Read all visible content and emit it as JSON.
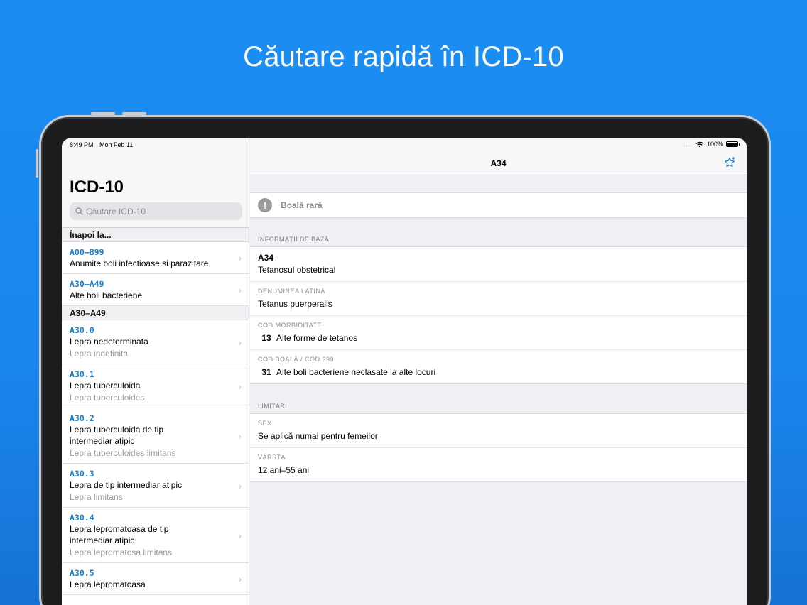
{
  "headline": "Căutare rapidă în ICD-10",
  "status_bar": {
    "time": "8:49 PM",
    "date": "Mon Feb 11",
    "battery": "100%",
    "dots": "...."
  },
  "master": {
    "title": "ICD-10",
    "search_placeholder": "Căutare ICD-10",
    "back_header": "Înapoi la...",
    "parents": [
      {
        "code": "A00–B99",
        "name": "Anumite boli infectioase si parazitare"
      },
      {
        "code": "A30–A49",
        "name": "Alte boli bacteriene"
      }
    ],
    "section_header": "A30–A49",
    "items": [
      {
        "code": "A30.0",
        "name": "Lepra nedeterminata",
        "latin": "Lepra indefinita"
      },
      {
        "code": "A30.1",
        "name": "Lepra tuberculoida",
        "latin": "Lepra tuberculoides"
      },
      {
        "code": "A30.2",
        "name": "Lepra tuberculoida de tip intermediar atipic",
        "latin": "Lepra tuberculoides limitans"
      },
      {
        "code": "A30.3",
        "name": "Lepra de tip intermediar atipic",
        "latin": "Lepra limitans"
      },
      {
        "code": "A30.4",
        "name": "Lepra lepromatoasa de tip intermediar atipic",
        "latin": "Lepra lepromatosa limitans"
      },
      {
        "code": "A30.5",
        "name": "Lepra lepromatoasa",
        "latin": ""
      }
    ]
  },
  "detail": {
    "nav_title": "A34",
    "rare_label": "Boală rară",
    "basic_header": "INFORMAȚII DE BAZĂ",
    "code": "A34",
    "code_name": "Tetanosul obstetrical",
    "latin_label": "DENUMIREA LATINĂ",
    "latin_value": "Tetanus puerperalis",
    "morb_label": "COD MORBIDITATE",
    "morb_num": "13",
    "morb_value": "Alte forme de tetanos",
    "disease_label": "COD BOALĂ / COD 999",
    "disease_num": "31",
    "disease_value": "Alte boli bacteriene neclasate la alte locuri",
    "limits_header": "LIMITĂRI",
    "sex_label": "SEX",
    "sex_value": "Se aplică numai pentru femeilor",
    "age_label": "VÂRSTĂ",
    "age_value": "12 ani–55 ani"
  },
  "colors": {
    "background": "#1a86ee",
    "accent": "#1a7fd0"
  },
  "icons": [
    "search-icon",
    "star-icon",
    "exclamation-icon",
    "wifi-icon",
    "battery-icon",
    "chevron-right-icon"
  ]
}
